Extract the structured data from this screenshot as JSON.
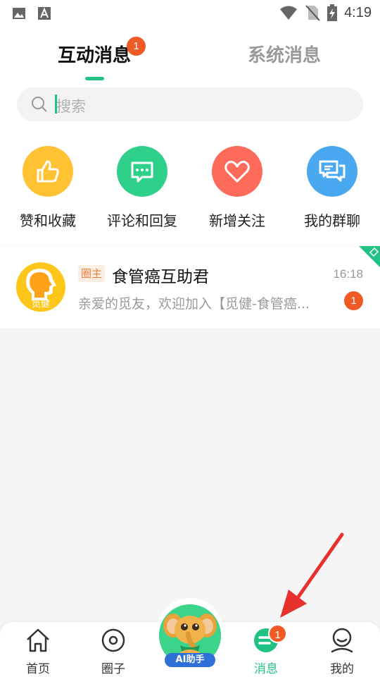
{
  "status_bar": {
    "time": "4:19",
    "left_icons": [
      "image-icon",
      "text-icon"
    ],
    "right_icons": [
      "wifi-icon",
      "no-sim-icon",
      "battery-charging-icon"
    ]
  },
  "tabs": [
    {
      "label": "互动消息",
      "badge": "1",
      "active": true
    },
    {
      "label": "系统消息",
      "active": false
    }
  ],
  "search": {
    "placeholder": "搜索"
  },
  "quick_actions": [
    {
      "label": "赞和收藏",
      "icon": "thumbs-up-icon",
      "color": "#FFC232"
    },
    {
      "label": "评论和回复",
      "icon": "comment-icon",
      "color": "#2ED08A"
    },
    {
      "label": "新增关注",
      "icon": "heart-icon",
      "color": "#FF6B5A"
    },
    {
      "label": "我的群聊",
      "icon": "group-chat-icon",
      "color": "#4AA8F0"
    }
  ],
  "messages": [
    {
      "avatar_text": "觅健",
      "tag": "圈主",
      "title": "食管癌互助君",
      "time": "16:18",
      "preview": "亲爱的觅友，欢迎加入【觅健-食管癌...",
      "unread": "1",
      "pinned": true
    }
  ],
  "bottom_nav": {
    "items": [
      {
        "label": "首页",
        "icon": "home-icon"
      },
      {
        "label": "圈子",
        "icon": "circle-icon"
      },
      {
        "label": "AI助手",
        "icon": "ai-assistant-icon"
      },
      {
        "label": "消息",
        "icon": "message-icon",
        "badge": "1",
        "active": true
      },
      {
        "label": "我的",
        "icon": "profile-icon"
      }
    ]
  },
  "colors": {
    "accent": "#22C285",
    "badge": "#F05A24",
    "annotation_arrow": "#E8312F"
  }
}
